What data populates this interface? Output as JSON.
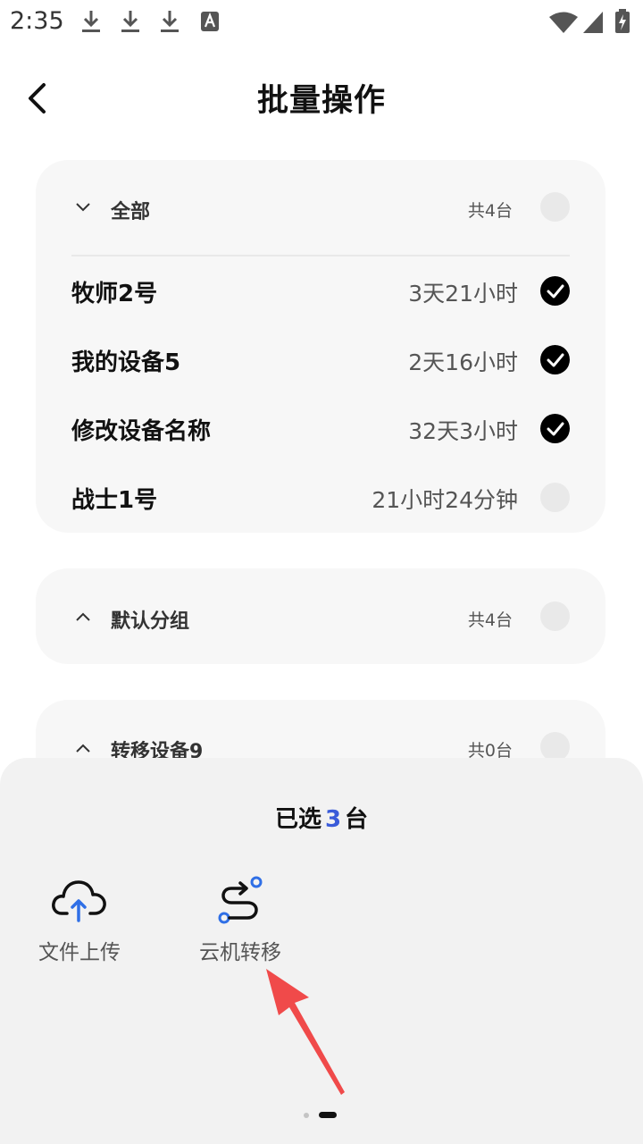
{
  "status_bar": {
    "time": "2:35",
    "left_icons": [
      "download-icon",
      "download-icon",
      "download-icon",
      "text-a-icon"
    ],
    "right_icons": [
      "wifi-icon",
      "signal-icon",
      "battery-charging-icon"
    ]
  },
  "header": {
    "title": "批量操作"
  },
  "groups": [
    {
      "name": "全部",
      "count": "共4台",
      "expanded": true,
      "devices": [
        {
          "name": "牧师2号",
          "time": "3天21小时",
          "checked": true
        },
        {
          "name": "我的设备5",
          "time": "2天16小时",
          "checked": true
        },
        {
          "name": "修改设备名称",
          "time": "32天3小时",
          "checked": true
        },
        {
          "name": "战士1号",
          "time": "21小时24分钟",
          "checked": false
        }
      ]
    },
    {
      "name": "默认分组",
      "count": "共4台",
      "expanded": false
    },
    {
      "name": "转移设备9",
      "count": "共0台",
      "expanded": false
    }
  ],
  "sheet": {
    "title_prefix": "已选",
    "selected_count": "3",
    "title_suffix": "台",
    "actions": [
      {
        "label": "文件上传",
        "icon": "cloud-upload-icon"
      },
      {
        "label": "云机转移",
        "icon": "transfer-route-icon"
      }
    ],
    "page_indicator": {
      "pages": 2,
      "active": 2
    }
  },
  "colors": {
    "accent": "#3a5bd9",
    "annotation_arrow": "#f04a4a",
    "card_bg": "#f7f7f7",
    "sheet_bg": "#f2f2f2"
  }
}
